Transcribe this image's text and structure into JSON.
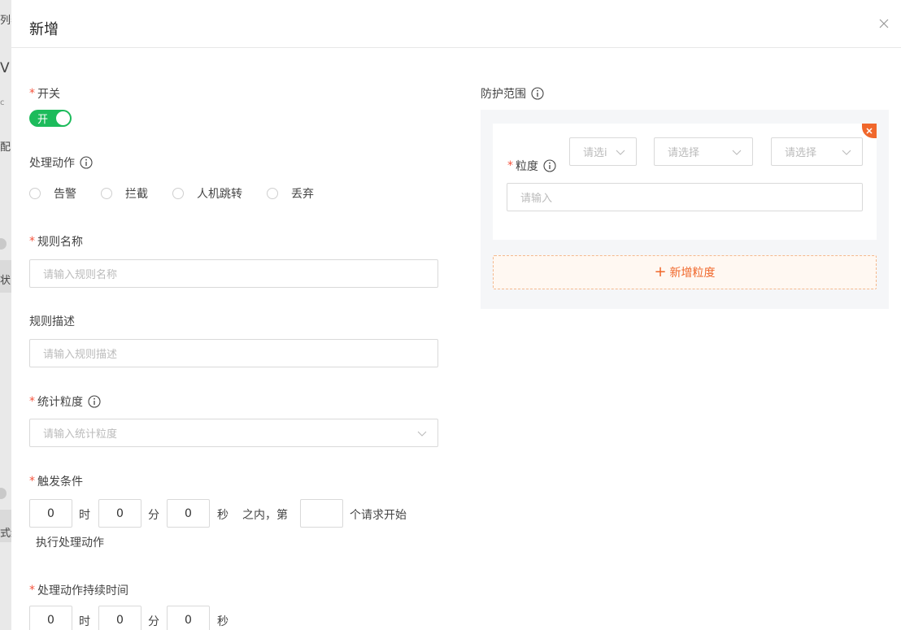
{
  "background": {
    "fragments": [
      "列表",
      "V",
      "c",
      "配",
      "状",
      "式缓"
    ]
  },
  "drawer": {
    "title": "新增"
  },
  "form": {
    "switch": {
      "label": "开关",
      "state_text": "开"
    },
    "action": {
      "label": "处理动作",
      "options": [
        "告警",
        "拦截",
        "人机跳转",
        "丢弃"
      ]
    },
    "rule_name": {
      "label": "规则名称",
      "placeholder": "请输入规则名称"
    },
    "rule_desc": {
      "label": "规则描述",
      "placeholder": "请输入规则描述"
    },
    "stat_granularity": {
      "label": "统计粒度",
      "placeholder": "请输入统计粒度"
    },
    "trigger": {
      "label": "触发条件",
      "hours": "0",
      "hour_unit": "时",
      "minutes": "0",
      "minute_unit": "分",
      "seconds": "0",
      "second_unit": "秒",
      "within_text": "之内，第",
      "count": "",
      "tail_text": "个请求开始",
      "line2": "执行处理动作"
    },
    "duration": {
      "label": "处理动作持续时间",
      "hours": "0",
      "hour_unit": "时",
      "minutes": "0",
      "minute_unit": "分",
      "seconds": "0",
      "second_unit": "秒"
    }
  },
  "protection": {
    "label": "防护范围",
    "granularity_label": "粒度",
    "select1": "请选i",
    "select2": "请选择",
    "select3": "请选择",
    "input_placeholder": "请输入",
    "add_label": "新增粒度"
  },
  "colors": {
    "accent": "#f0672b",
    "switch_on": "#1cbb5b",
    "required": "#f5533d"
  }
}
